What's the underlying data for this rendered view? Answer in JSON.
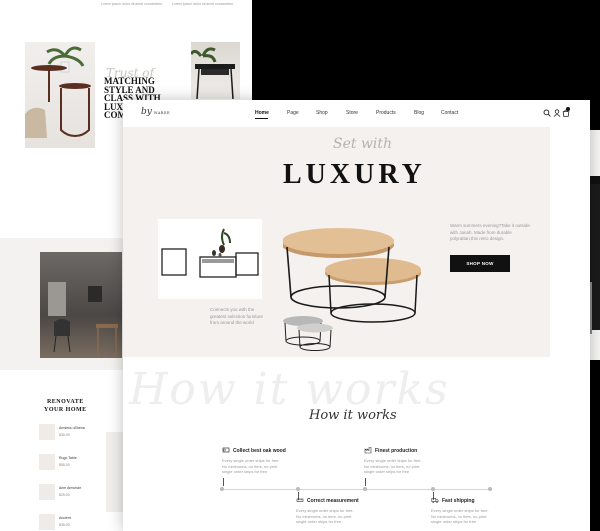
{
  "back_page": {
    "top_text_1": "Lorem ipsum dolor sit amet consectetur",
    "top_text_2": "Lorem ipsum dolor sit amet consectetur",
    "headline_script": "Trust of",
    "headline": "MATCHING STYLE AND CLASS WITH LUXURY AND COM",
    "renovate_line1": "RENOVATE",
    "renovate_line2": "YOUR HOME",
    "products": [
      {
        "name": "Armless uShena",
        "price": "$35.00"
      },
      {
        "name": "Rugo Table",
        "price": "$55.00"
      },
      {
        "name": "Arim Armchair",
        "price": "$25.00"
      },
      {
        "name": "Ancient",
        "price": "$35.00"
      }
    ]
  },
  "nav": {
    "logo_script": "by",
    "logo_small": "WAREE",
    "items": [
      "Home",
      "Page",
      "Shop",
      "Store",
      "Products",
      "Blog",
      "Contact"
    ],
    "active": "Home",
    "icons": [
      "search-icon",
      "user-icon",
      "cart-icon"
    ]
  },
  "hero": {
    "script": "Set with",
    "title": "LUXURY",
    "caption": "Connects you with the greatest selection furniture from around the world",
    "description": "Warm summers evening?Take it outside with Janah. Made from durable polyrattan,this retro design.",
    "button": "SHOP NOW"
  },
  "how_it_works": {
    "background_script": "How it works",
    "title": "How it works",
    "steps": [
      {
        "title": "Collect best oak wood",
        "text": "Every single order ships for free. No minimums, no tiers, no print single order ships for free",
        "icon": "wood-icon"
      },
      {
        "title": "Finest production",
        "text": "Every single order ships for free. No minimums, no tiers, no print single order ships for free",
        "icon": "factory-icon"
      },
      {
        "title": "Correct measurement",
        "text": "Every single order ships for free. No minimums, no tiers, no print single order ships for free",
        "icon": "measure-icon"
      },
      {
        "title": "Fast shipping",
        "text": "Every single order ships for free. No minimums, no tiers, no print single order ships for free",
        "icon": "truck-icon"
      }
    ]
  },
  "colors": {
    "hero_bg": "#f5f1ee",
    "accent": "#111111",
    "wood": "#d9b285"
  }
}
